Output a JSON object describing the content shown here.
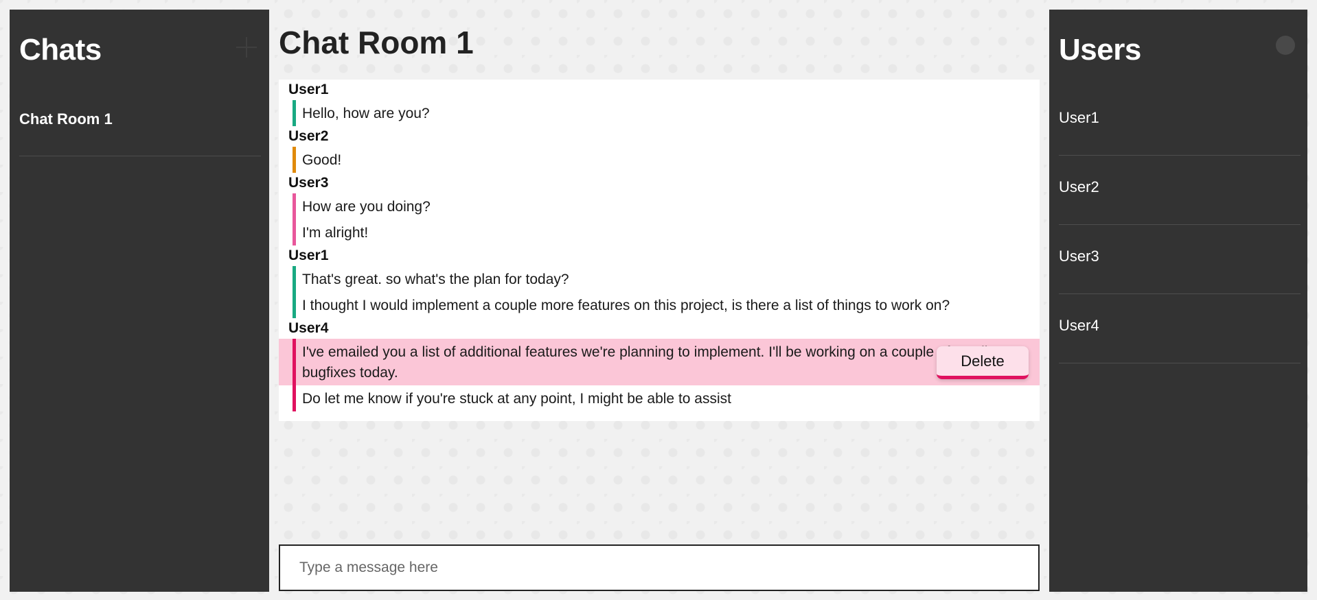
{
  "chats_panel": {
    "title": "Chats",
    "add_icon": "plus-icon",
    "items": [
      {
        "label": "Chat Room 1"
      }
    ]
  },
  "chat_room": {
    "title": "Chat Room 1",
    "context_menu": {
      "delete_label": "Delete"
    },
    "input_placeholder": "Type a message here",
    "groups": [
      {
        "author": "User1",
        "color": "#19a982",
        "messages": [
          "Hello, how are you?"
        ]
      },
      {
        "author": "User2",
        "color": "#e08a0b",
        "messages": [
          "Good!"
        ]
      },
      {
        "author": "User3",
        "color": "#e8579b",
        "messages": [
          "How are you doing?",
          "I'm alright!"
        ]
      },
      {
        "author": "User1",
        "color": "#19a982",
        "messages": [
          "That's great. so what's the plan for today?",
          "I thought I would implement a couple more features on this project, is there a list of things to work on?"
        ]
      },
      {
        "author": "User4",
        "color": "#e0115f",
        "messages": [
          "I've emailed you a list of additional features we're planning to implement. I'll be working on a couple of small bugfixes today.",
          "Do let me know if you're stuck at any point, I might be able to assist"
        ]
      }
    ]
  },
  "users_panel": {
    "title": "Users",
    "status_icon": "status-dot-icon",
    "items": [
      {
        "label": "User1"
      },
      {
        "label": "User2"
      },
      {
        "label": "User3"
      },
      {
        "label": "User4"
      }
    ]
  }
}
